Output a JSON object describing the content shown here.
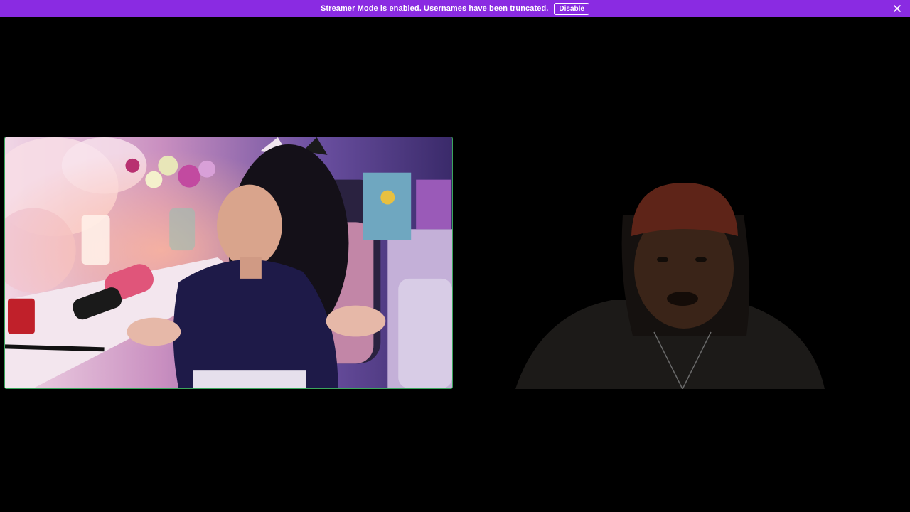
{
  "banner": {
    "message": "Streamer Mode is enabled. Usernames have been truncated.",
    "disable_label": "Disable",
    "background": "#8a2be2"
  },
  "tiles": {
    "left": {
      "speaking_border_color": "#3ba55c"
    },
    "right": {}
  }
}
